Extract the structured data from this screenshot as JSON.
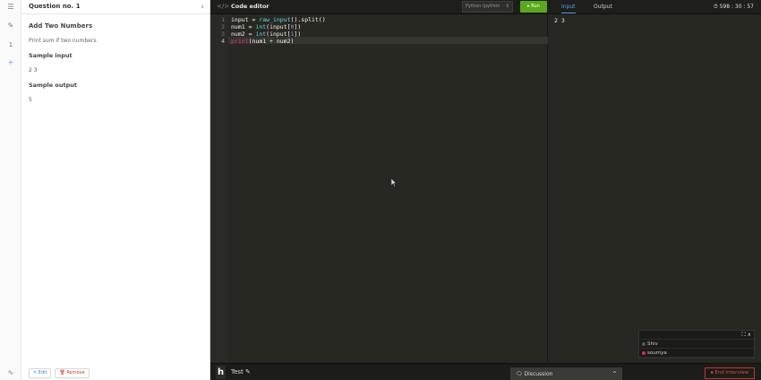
{
  "rail": {
    "icons": [
      "menu-icon",
      "edit-icon",
      "question-index",
      "add-icon",
      "activity-icon"
    ],
    "question_index": "1",
    "menu_glyph": "☰",
    "edit_glyph": "✎",
    "add_glyph": "+",
    "activity_glyph": "∿"
  },
  "question": {
    "header": "Question no. 1",
    "collapse_glyph": "‹",
    "title": "Add Two Numbers",
    "description": "Print sum if two numbers.",
    "sample_input_label": "Sample input",
    "sample_input": "2 3",
    "sample_output_label": "Sample output",
    "sample_output": "5",
    "edit_label": "✎ Edit",
    "remove_label": "🗑 Remove"
  },
  "toolbar": {
    "code_icon_glyph": "</>",
    "title": "Code editor",
    "language": "Python (python",
    "language_caret": "⇕",
    "run_label": "▸ Run",
    "tab_input": "Input",
    "tab_output": "Output",
    "timer": "⏱ 598 : 30 : 57"
  },
  "editor": {
    "line_numbers": [
      "1",
      "2",
      "3",
      "4"
    ],
    "active_line": 4
  },
  "io": {
    "input_value": "2 3"
  },
  "participants": {
    "header_glyphs": "⛶ ∧",
    "people": [
      {
        "name": "Shiv",
        "color": "#555555"
      },
      {
        "name": "soumya",
        "color": "#e0245e"
      }
    ]
  },
  "bottom": {
    "logo": "h",
    "test_label": "Test ✎",
    "discussion_label": "🗨 Discussion",
    "discussion_caret": "^",
    "end_label": "⏹ End interview"
  },
  "colors": {
    "run": "#5aa81e",
    "accent": "#5b9df0",
    "danger": "#e74c3c"
  }
}
